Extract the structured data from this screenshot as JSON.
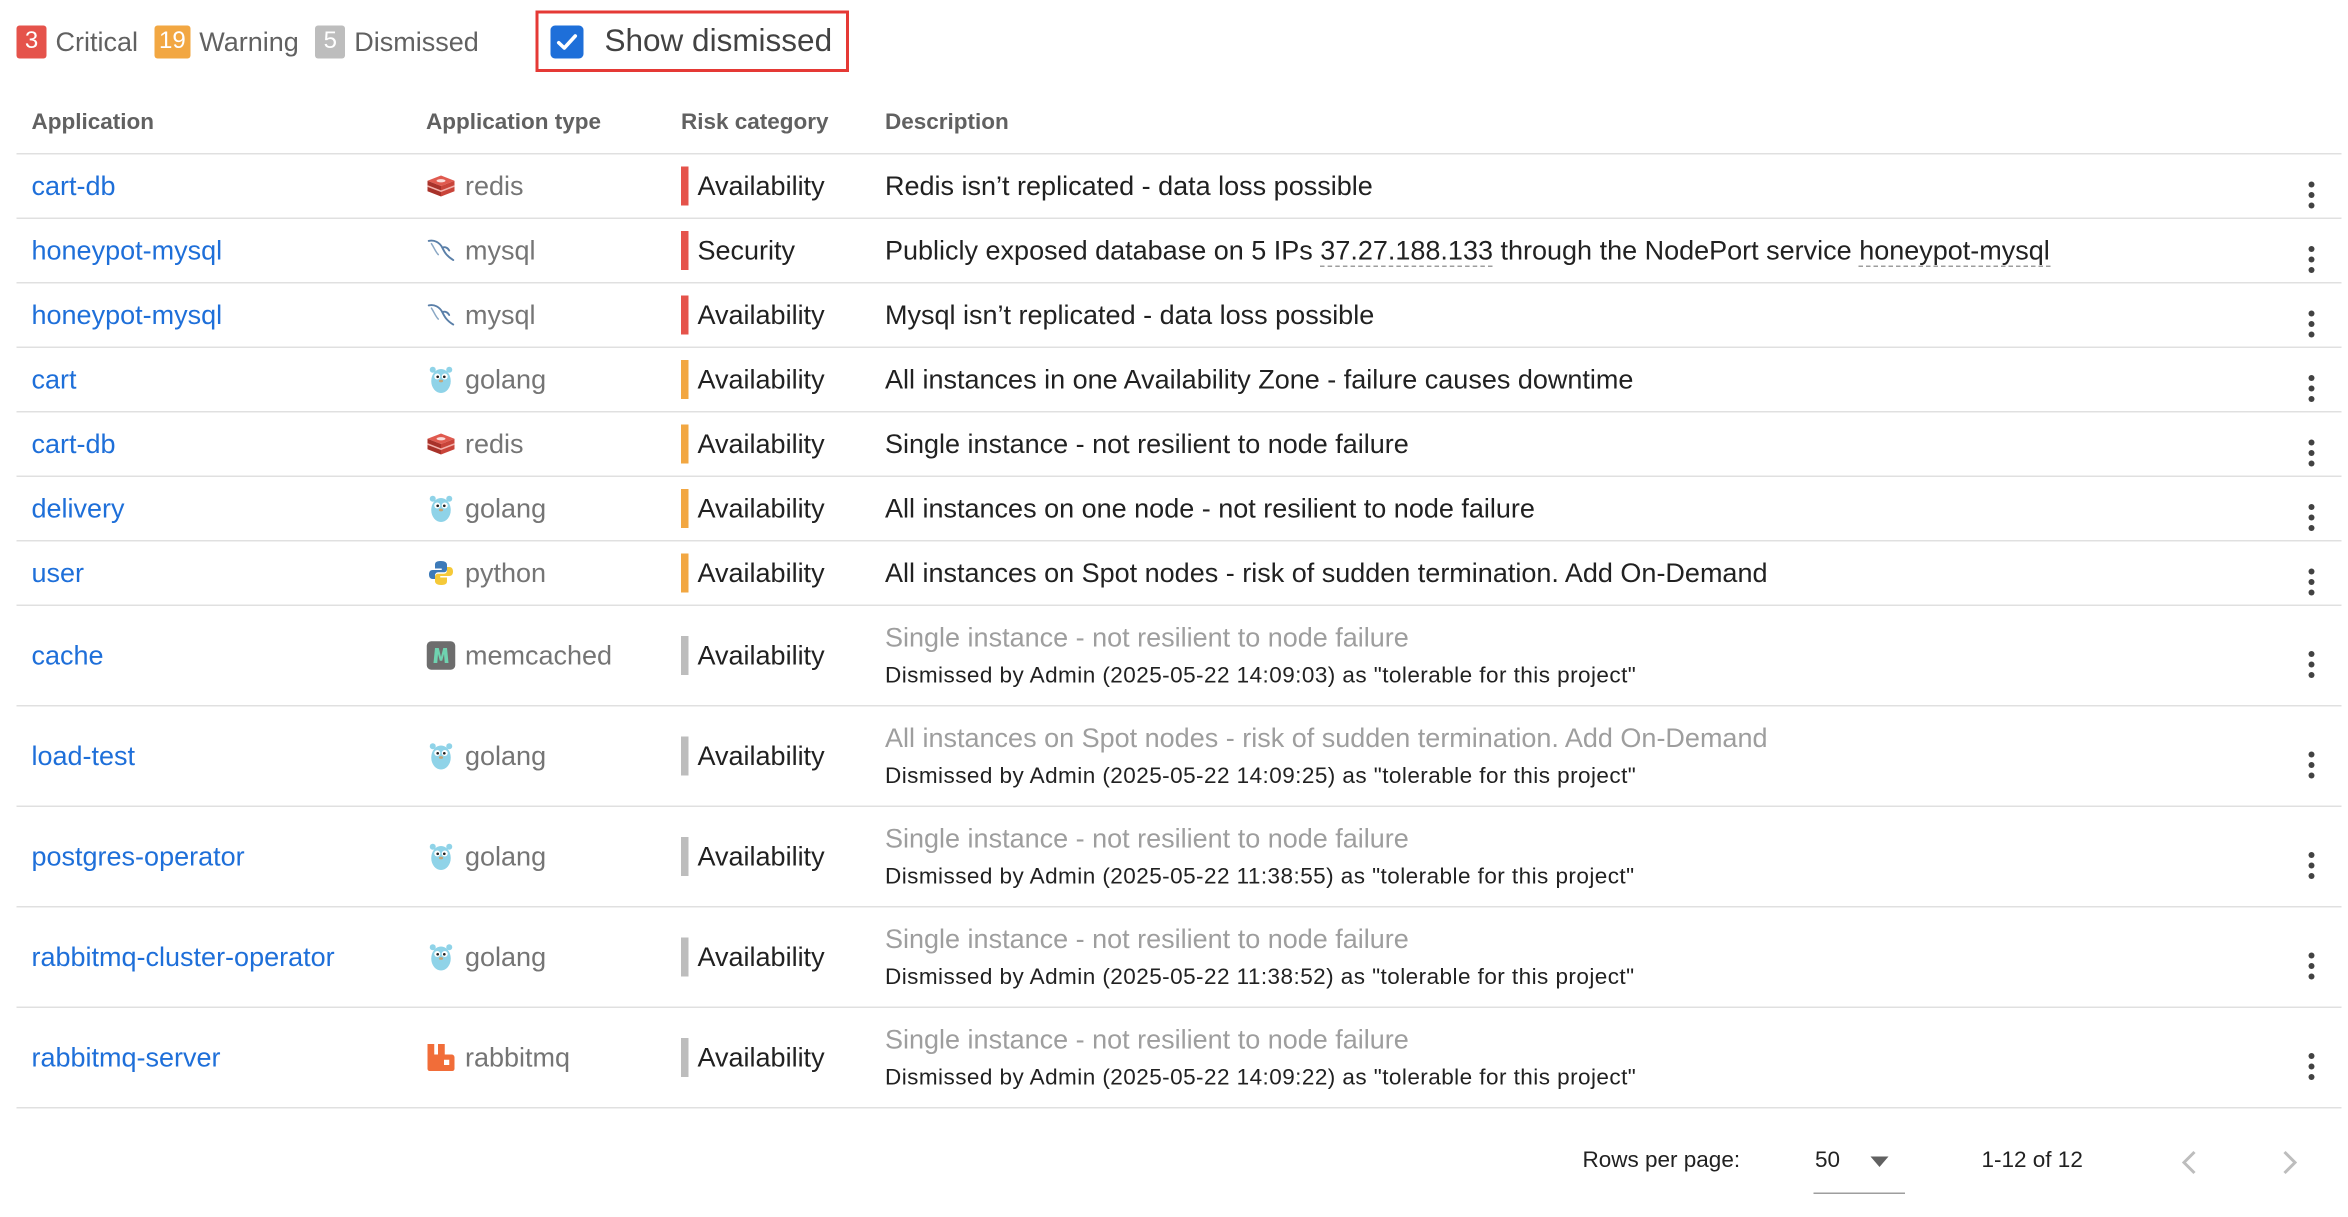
{
  "filters": {
    "critical": {
      "count": "3",
      "label": "Critical"
    },
    "warning": {
      "count": "19",
      "label": "Warning"
    },
    "dismissed": {
      "count": "5",
      "label": "Dismissed"
    },
    "show_dismissed": {
      "label": "Show dismissed",
      "checked": true
    }
  },
  "table": {
    "headers": [
      "Application",
      "Application type",
      "Risk category",
      "Description"
    ],
    "rows": [
      {
        "app": "cart-db",
        "type": "redis",
        "type_icon": "redis-icon",
        "risk": "Availability",
        "severity": "critical",
        "desc": "Redis isn’t replicated - data loss possible"
      },
      {
        "app": "honeypot-mysql",
        "type": "mysql",
        "type_icon": "mysql-icon",
        "risk": "Security",
        "severity": "critical",
        "desc_pre": "Publicly exposed database on 5 IPs ",
        "desc_ip": "37.27.188.133",
        "desc_mid": " through the NodePort service ",
        "desc_svc": "honeypot-mysql"
      },
      {
        "app": "honeypot-mysql",
        "type": "mysql",
        "type_icon": "mysql-icon",
        "risk": "Availability",
        "severity": "critical",
        "desc": "Mysql isn’t replicated - data loss possible"
      },
      {
        "app": "cart",
        "type": "golang",
        "type_icon": "golang-icon",
        "risk": "Availability",
        "severity": "warning",
        "desc": "All instances in one Availability Zone - failure causes downtime"
      },
      {
        "app": "cart-db",
        "type": "redis",
        "type_icon": "redis-icon",
        "risk": "Availability",
        "severity": "warning",
        "desc": "Single instance - not resilient to node failure"
      },
      {
        "app": "delivery",
        "type": "golang",
        "type_icon": "golang-icon",
        "risk": "Availability",
        "severity": "warning",
        "desc": "All instances on one node - not resilient to node failure"
      },
      {
        "app": "user",
        "type": "python",
        "type_icon": "python-icon",
        "risk": "Availability",
        "severity": "warning",
        "desc": "All instances on Spot nodes - risk of sudden termination. Add On-Demand"
      },
      {
        "app": "cache",
        "type": "memcached",
        "type_icon": "memcached-icon",
        "risk": "Availability",
        "severity": "dismissed",
        "desc": "Single instance - not resilient to node failure",
        "note": "Dismissed by Admin (2025-05-22 14:09:03) as \"tolerable for this project\""
      },
      {
        "app": "load-test",
        "type": "golang",
        "type_icon": "golang-icon",
        "risk": "Availability",
        "severity": "dismissed",
        "desc": "All instances on Spot nodes - risk of sudden termination. Add On-Demand",
        "note": "Dismissed by Admin (2025-05-22 14:09:25) as \"tolerable for this project\""
      },
      {
        "app": "postgres-operator",
        "type": "golang",
        "type_icon": "golang-icon",
        "risk": "Availability",
        "severity": "dismissed",
        "desc": "Single instance - not resilient to node failure",
        "note": "Dismissed by Admin (2025-05-22 11:38:55) as \"tolerable for this project\""
      },
      {
        "app": "rabbitmq-cluster-operator",
        "type": "golang",
        "type_icon": "golang-icon",
        "risk": "Availability",
        "severity": "dismissed",
        "desc": "Single instance - not resilient to node failure",
        "note": "Dismissed by Admin (2025-05-22 11:38:52) as \"tolerable for this project\""
      },
      {
        "app": "rabbitmq-server",
        "type": "rabbitmq",
        "type_icon": "rabbitmq-icon",
        "risk": "Availability",
        "severity": "dismissed",
        "desc": "Single instance - not resilient to node failure",
        "note": "Dismissed by Admin (2025-05-22 14:09:22) as \"tolerable for this project\""
      }
    ]
  },
  "pagination": {
    "rows_per_page_label": "Rows per page:",
    "rows_per_page": "50",
    "range": "1-12 of 12"
  },
  "colors": {
    "critical": "#e5534b",
    "warning": "#f2a742",
    "dismissed": "#bdbdbd",
    "link": "#1e6fd9",
    "highlight_border": "#e53935"
  }
}
